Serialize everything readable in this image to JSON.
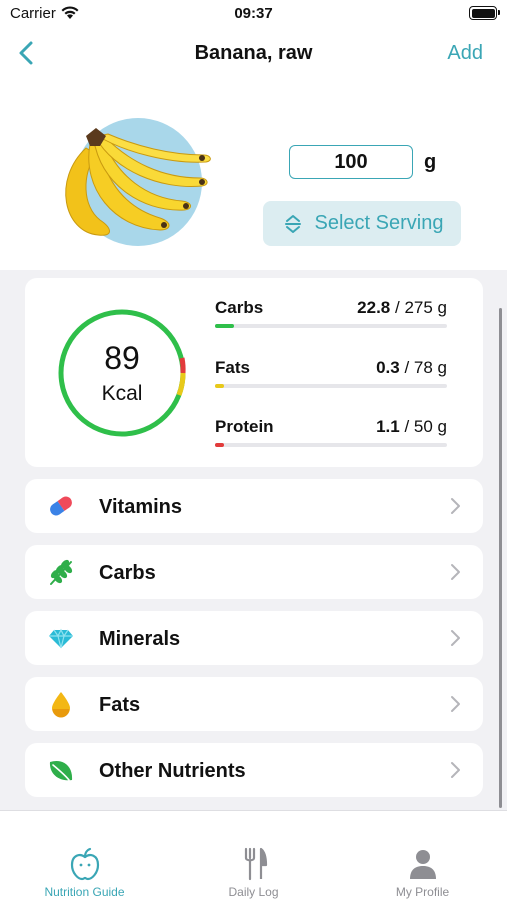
{
  "status_bar": {
    "carrier": "Carrier",
    "time": "09:37"
  },
  "nav": {
    "title": "Banana, raw",
    "add_label": "Add"
  },
  "portion": {
    "amount": "100",
    "unit": "g",
    "serving_button_label": "Select Serving"
  },
  "energy": {
    "value": "89",
    "unit": "Kcal"
  },
  "macros": [
    {
      "name": "Carbs",
      "value": "22.8",
      "target": "/ 275 g",
      "value_num": 22.8,
      "target_num": 275,
      "color": "#2fbf4a"
    },
    {
      "name": "Fats",
      "value": "0.3",
      "target": "/ 78 g",
      "value_num": 0.3,
      "target_num": 78,
      "color": "#e8c91a"
    },
    {
      "name": "Protein",
      "value": "1.1",
      "target": "/ 50 g",
      "value_num": 1.1,
      "target_num": 50,
      "color": "#e23b3b"
    }
  ],
  "nutrient_groups": [
    {
      "label": "Vitamins",
      "icon": "pill-icon"
    },
    {
      "label": "Carbs",
      "icon": "wheat-icon"
    },
    {
      "label": "Minerals",
      "icon": "diamond-icon"
    },
    {
      "label": "Fats",
      "icon": "oil-drop-icon"
    },
    {
      "label": "Other Nutrients",
      "icon": "leaf-icon"
    }
  ],
  "tabs": [
    {
      "label": "Nutrition Guide",
      "icon": "apple-icon",
      "active": true
    },
    {
      "label": "Daily Log",
      "icon": "fork-knife-icon",
      "active": false
    },
    {
      "label": "My Profile",
      "icon": "person-icon",
      "active": false
    }
  ],
  "colors": {
    "accent": "#3aa6b5",
    "ring_green": "#2fbf4a",
    "ring_red": "#e23b3b",
    "ring_yellow": "#e8c91a"
  }
}
